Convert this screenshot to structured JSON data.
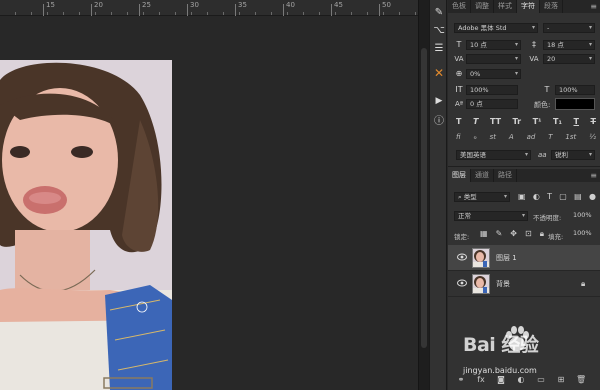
{
  "ruler": {
    "ticks": [
      "15",
      "20",
      "25",
      "30",
      "35",
      "40",
      "45",
      "50"
    ]
  },
  "tools": [
    {
      "name": "brush-tool-icon",
      "glyph": "✎"
    },
    {
      "name": "pen-path-icon",
      "glyph": "⌥"
    },
    {
      "name": "adjust-sliders-icon",
      "glyph": "☰"
    },
    {
      "name": "crossed-tools-icon",
      "glyph": "✕"
    },
    {
      "name": "play-action-icon",
      "glyph": "▶"
    },
    {
      "name": "info-panel-icon",
      "glyph": "ⓘ"
    }
  ],
  "top_tabs": [
    "色板",
    "调整",
    "样式",
    "字符",
    "段落"
  ],
  "active_top_tab": "字符",
  "character": {
    "font_family": "Adobe 黑体 Std",
    "font_style": "-",
    "font_size": "10 点",
    "leading": "18 点",
    "kerning": "",
    "tracking": "20",
    "scale_percent": "0%",
    "vertical_scale": "100%",
    "horizontal_scale": "100%",
    "baseline_shift": "0 点",
    "color_label": "颜色:",
    "color_value": "#000000",
    "type_buttons": [
      "T",
      "T",
      "TT",
      "Tr",
      "T¹",
      "T₁",
      "T",
      "T"
    ],
    "opentype_buttons": [
      "fi",
      "ℴ",
      "st",
      "A",
      "ad",
      "T",
      "1st",
      "½"
    ],
    "language": "美国英语",
    "aa_label": "aa",
    "aa_mode": "锐利"
  },
  "layer_tabs": [
    "图层",
    "通道",
    "路径"
  ],
  "active_layer_tab": "图层",
  "layers_panel": {
    "filter_kind": "类型",
    "blend_mode": "正常",
    "opacity_label": "不透明度:",
    "opacity_value": "100%",
    "lock_label": "锁定:",
    "fill_label": "填充:",
    "fill_value": "100%"
  },
  "layers": [
    {
      "name": "图层 1",
      "selected": true
    },
    {
      "name": "背景",
      "selected": false,
      "locked": true
    }
  ],
  "watermark": {
    "brand": "Bai  经验",
    "url": "jingyan.baidu.com"
  }
}
